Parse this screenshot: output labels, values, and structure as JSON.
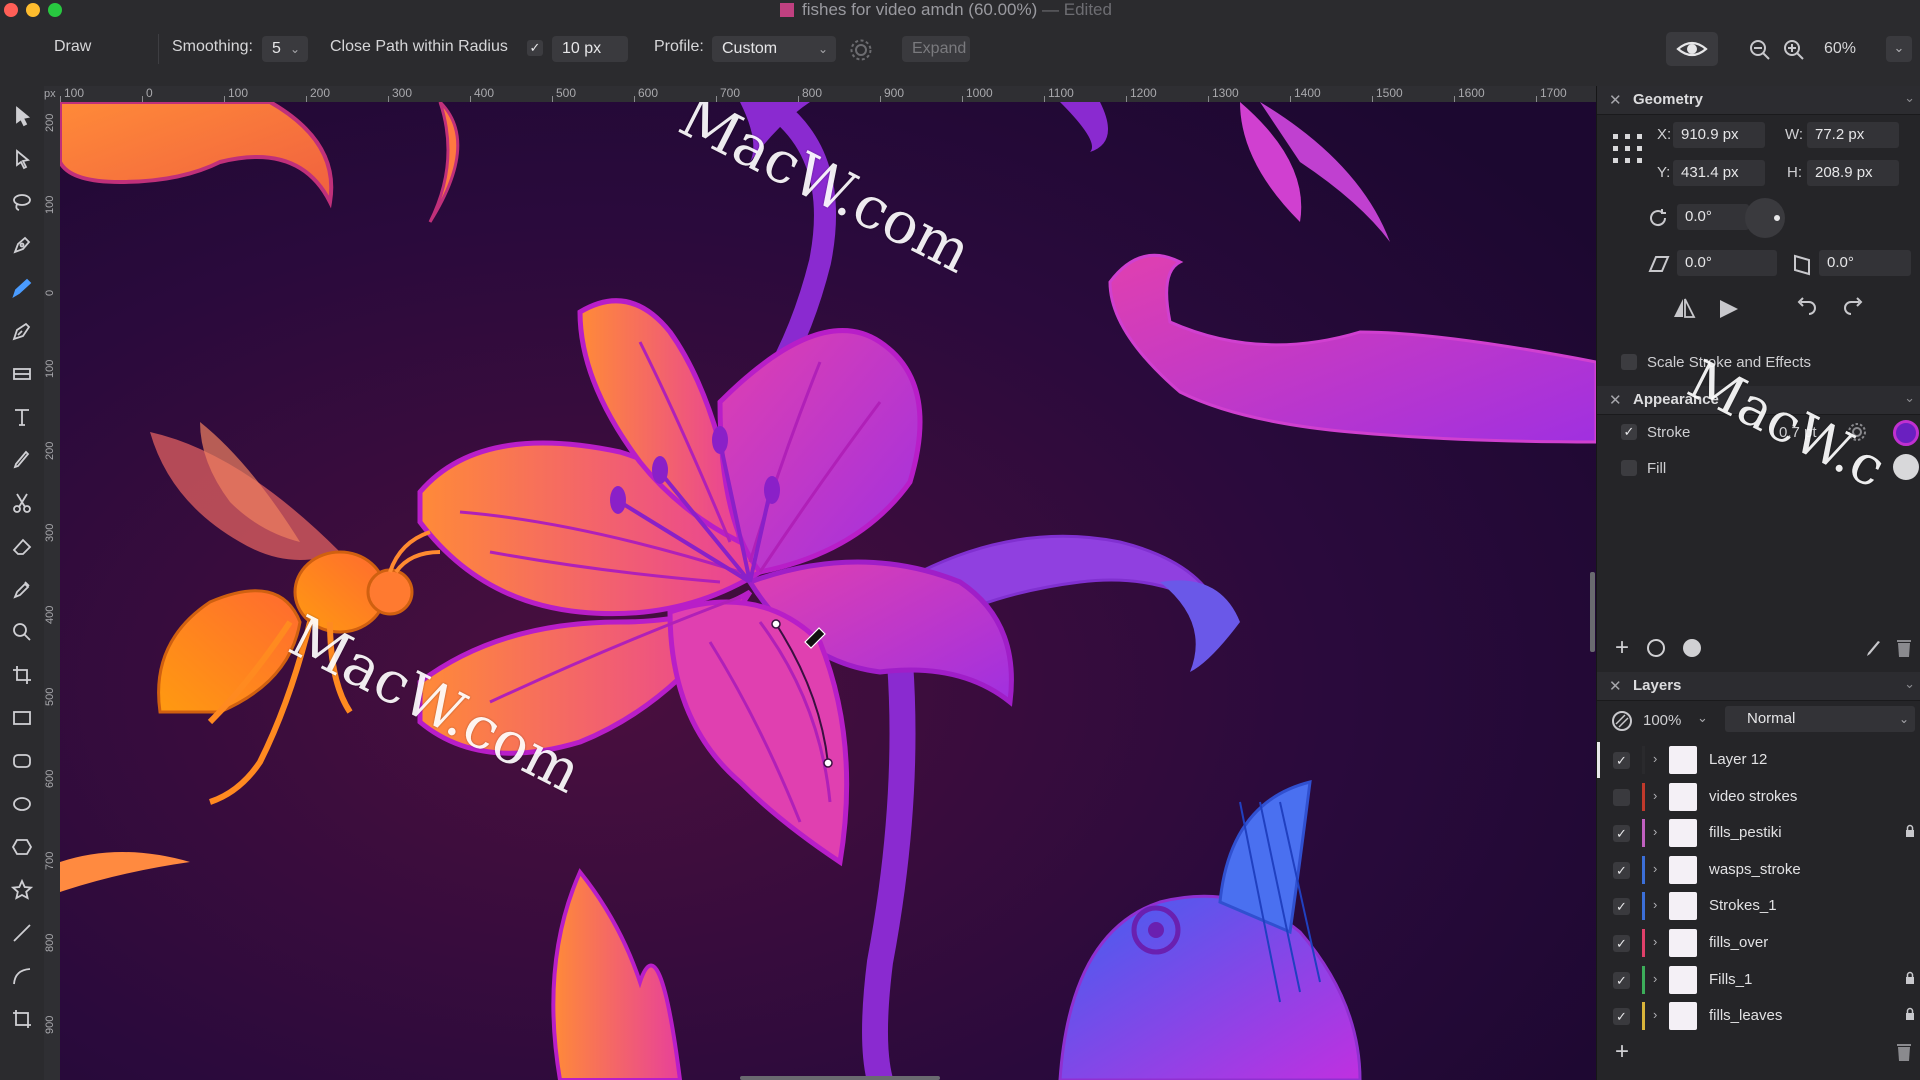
{
  "window": {
    "title": "fishes for video amdn (60.00%)",
    "edited": "— Edited"
  },
  "toolbar": {
    "persona": "Draw",
    "smoothing_label": "Smoothing:",
    "smoothing_value": "5",
    "close_path_label": "Close Path within Radius",
    "close_path_checked": true,
    "radius_value": "10 px",
    "profile_label": "Profile:",
    "profile_value": "Custom",
    "expand_label": "Expand",
    "zoom_value": "60%"
  },
  "ruler": {
    "top_ticks": [
      "100",
      "0",
      "100",
      "200",
      "300",
      "400",
      "500",
      "600",
      "700",
      "800",
      "900",
      "1000",
      "1100",
      "1200",
      "1300",
      "1400",
      "1500",
      "1600",
      "1700"
    ],
    "left_ticks": [
      "200",
      "100",
      "0",
      "100",
      "200",
      "300",
      "400",
      "500",
      "600",
      "700",
      "800",
      "900"
    ],
    "unit": "px"
  },
  "tools": [
    "move-tool",
    "node-tool",
    "lasso-tool",
    "pen-tool",
    "pencil-tool",
    "vector-brush-tool",
    "fill-tool",
    "text-tool",
    "paint-brush-tool",
    "scissors-tool",
    "eraser-tool",
    "eyedropper-tool",
    "zoom-tool",
    "crop-tool",
    "rectangle-tool",
    "rounded-rectangle-tool",
    "ellipse-tool",
    "polygon-tool",
    "star-tool",
    "line-tool",
    "curve-tool",
    "artboard-tool"
  ],
  "geometry": {
    "title": "Geometry",
    "x_label": "X:",
    "x": "910.9 px",
    "y_label": "Y:",
    "y": "431.4 px",
    "w_label": "W:",
    "w": "77.2 px",
    "h_label": "H:",
    "h": "208.9 px",
    "rotation": "0.0°",
    "shear": "0.0°",
    "shear2": "0.0°",
    "scale_stroke_label": "Scale Stroke and Effects"
  },
  "appearance": {
    "title": "Appearance",
    "stroke_label": "Stroke",
    "stroke_value": "0.7 pt",
    "fill_label": "Fill"
  },
  "layers": {
    "title": "Layers",
    "opacity": "100%",
    "blend_mode": "Normal",
    "items": [
      {
        "name": "Layer 12",
        "checked": true,
        "color": "#2a2a2d",
        "locked": false
      },
      {
        "name": "video strokes",
        "checked": false,
        "color": "#c0392b",
        "locked": false
      },
      {
        "name": "fills_pestiki",
        "checked": true,
        "color": "#c060c0",
        "locked": true
      },
      {
        "name": "wasps_stroke",
        "checked": true,
        "color": "#3b6fd8",
        "locked": false
      },
      {
        "name": "Strokes_1",
        "checked": true,
        "color": "#3b6fd8",
        "locked": false
      },
      {
        "name": "fills_over",
        "checked": true,
        "color": "#e0406a",
        "locked": false
      },
      {
        "name": "Fills_1",
        "checked": true,
        "color": "#3cae5a",
        "locked": true
      },
      {
        "name": "fills_leaves",
        "checked": true,
        "color": "#d9b43a",
        "locked": true
      }
    ]
  },
  "watermarks": [
    "MacW.com",
    "MacW.com",
    "MacW.c"
  ],
  "colors": {
    "accent": "#4a9cff",
    "canvas_bg": "#2a0a3c"
  }
}
